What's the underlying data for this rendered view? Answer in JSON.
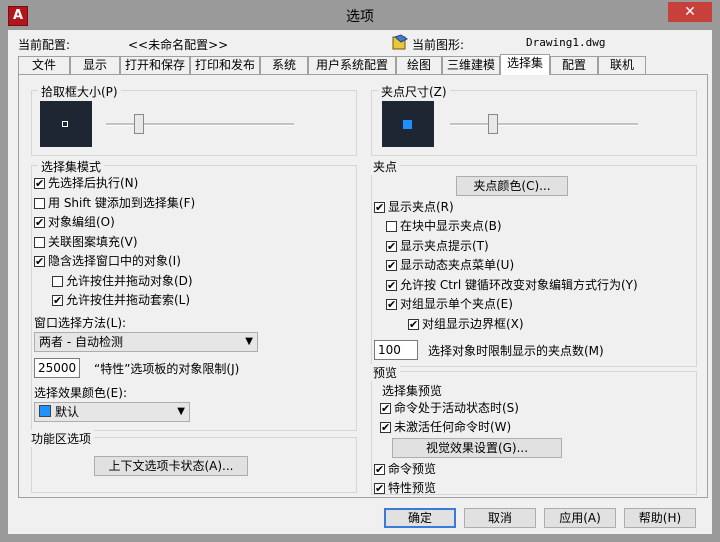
{
  "window": {
    "title": "选项",
    "app_icon": "autocad-icon",
    "close": "✕"
  },
  "header": {
    "current_profile_label": "当前配置:",
    "current_profile_value": "<<未命名配置>>",
    "current_drawing_label": "当前图形:",
    "current_drawing_value": "Drawing1.dwg"
  },
  "tabs": [
    "文件",
    "显示",
    "打开和保存",
    "打印和发布",
    "系统",
    "用户系统配置",
    "绘图",
    "三维建模",
    "选择集",
    "配置",
    "联机"
  ],
  "active_tab": "选择集",
  "pickbox": {
    "title": "拾取框大小(P)",
    "level": 0.25
  },
  "grip_size": {
    "title": "夹点尺寸(Z)",
    "level": 0.3
  },
  "selection_modes": {
    "title": "选择集模式",
    "items": [
      {
        "label": "先选择后执行(N)",
        "checked": true
      },
      {
        "label": "用 Shift 键添加到选择集(F)",
        "checked": false
      },
      {
        "label": "对象编组(O)",
        "checked": true
      },
      {
        "label": "关联图案填充(V)",
        "checked": false
      },
      {
        "label": "隐含选择窗口中的对象(I)",
        "checked": true
      },
      {
        "label": "允许按住并拖动对象(D)",
        "checked": false
      },
      {
        "label": "允许按住并拖动套索(L)",
        "checked": true
      }
    ],
    "window_method_label": "窗口选择方法(L):",
    "window_method_value": "两者 - 自动检测",
    "limit_value": "25000",
    "limit_label": "“特性”选项板的对象限制(J)",
    "effect_color_label": "选择效果颜色(E):",
    "effect_color_value": "默认"
  },
  "ribbon": {
    "title": "功能区选项",
    "button": "上下文选项卡状态(A)..."
  },
  "grips": {
    "title": "夹点",
    "color_button": "夹点颜色(C)...",
    "items": [
      {
        "label": "显示夹点(R)",
        "checked": true
      },
      {
        "label": "在块中显示夹点(B)",
        "checked": false
      },
      {
        "label": "显示夹点提示(T)",
        "checked": true
      },
      {
        "label": "显示动态夹点菜单(U)",
        "checked": true
      },
      {
        "label": "允许按 Ctrl 键循环改变对象编辑方式行为(Y)",
        "checked": true
      },
      {
        "label": "对组显示单个夹点(E)",
        "checked": true
      },
      {
        "label": "对组显示边界框(X)",
        "checked": true
      }
    ],
    "limit_value": "100",
    "limit_label": "选择对象时限制显示的夹点数(M)"
  },
  "preview": {
    "title": "预览",
    "sub_title": "选择集预览",
    "items": [
      {
        "label": "命令处于活动状态时(S)",
        "checked": true
      },
      {
        "label": "未激活任何命令时(W)",
        "checked": true
      }
    ],
    "visual_button": "视觉效果设置(G)...",
    "items2": [
      {
        "label": "命令预览",
        "checked": true
      },
      {
        "label": "特性预览",
        "checked": true
      }
    ]
  },
  "footer": {
    "ok": "确定",
    "cancel": "取消",
    "apply": "应用(A)",
    "help": "帮助(H)"
  },
  "colors": {
    "title_bg": "#9a9a9a",
    "close_bg": "#c8403c",
    "preview_bg": "#1e2533",
    "grip_blue": "#1e90ff"
  }
}
